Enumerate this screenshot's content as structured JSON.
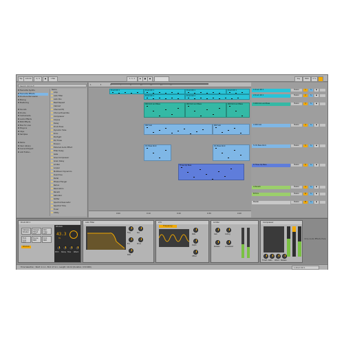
{
  "transport": {
    "tap": "Tap",
    "tempo": "120.00",
    "time_sig": "4 / 4",
    "quantize": "1 Bar",
    "position": "1. 1. 1",
    "key": "Key",
    "midi": "MIDI",
    "cpu": "5 %"
  },
  "browser": {
    "search_placeholder": "Search (Cmd+F)",
    "collections": [
      "Favourite Synths",
      "Favourite Effects",
      "Drums & Percussion",
      "Mixing",
      "Mastering"
    ],
    "categories": [
      "Sounds",
      "Drums",
      "Instruments",
      "Audio Effects",
      "MIDI Effects",
      "Max for Live",
      "Plug-ins",
      "Clips",
      "Samples"
    ],
    "places": [
      "Packs",
      "User Library",
      "Current Project",
      "Add Folder..."
    ],
    "name_header": "Name",
    "items": [
      "Amp",
      "Auto Filter",
      "Auto Pan",
      "Beat Repeat",
      "Cabinet",
      "Channel EQ",
      "Chorus-Ensemble",
      "Compressor",
      "Corpus",
      "Delay",
      "Drum Buss",
      "Dynamic Tube",
      "Echo",
      "EQ Eight",
      "EQ Three",
      "Erosion",
      "External Audio Effect",
      "Filter Delay",
      "Gate",
      "Glue Compressor",
      "Grain Delay",
      "Limiter",
      "Looper",
      "Multiband Dynamics",
      "Overdrive",
      "Pedal",
      "Phaser-Flanger",
      "Redux",
      "Resonators",
      "Reverb",
      "Saturator",
      "Shifter",
      "Spectral Resonator",
      "Spectral Time",
      "Tuner",
      "Utility"
    ]
  },
  "arrangement": {
    "ruler": [
      "1",
      "3",
      "5",
      "7",
      "9",
      "11",
      "13",
      "15",
      "17"
    ],
    "clips": [
      {
        "label": "Drum Kit 1",
        "color": "#29c4d8"
      },
      {
        "label": "Drum Kit 1",
        "color": "#29c4d8"
      },
      {
        "label": "Drum Kit 1",
        "color": "#29c4d8"
      },
      {
        "label": "Drum Kit 1",
        "color": "#29c4d8"
      },
      {
        "label": "Drum Kit 1",
        "color": "#29c4d8"
      },
      {
        "label": "Drum Kit 1",
        "color": "#29c4d8"
      },
      {
        "label": "909 Kick and Bass",
        "color": "#34b9a5"
      },
      {
        "label": "909 Kick and Bass",
        "color": "#34b9a5"
      },
      {
        "label": "909 Kick and Bass",
        "color": "#34b9a5"
      },
      {
        "label": "909 Sub",
        "color": "#7fb7e6"
      },
      {
        "label": "909 Sub",
        "color": "#7fb7e6"
      },
      {
        "label": "Chi Bass Rock",
        "color": "#7fb7e6"
      },
      {
        "label": "Chi Bass Rock",
        "color": "#7fb7e6"
      },
      {
        "label": "Three Op Bass",
        "color": "#5f7ddb"
      }
    ],
    "time_labels": [
      "0:00",
      "0:10",
      "0:20",
      "0:30",
      "0:40"
    ]
  },
  "tracks": [
    {
      "name": "1 Drum Kit 1",
      "color": "#29c4d8",
      "num": "1"
    },
    {
      "name": "2 Drum Kit 1",
      "color": "#29c4d8",
      "num": "2"
    },
    {
      "name": "3 909 Kick and Bass",
      "color": "#34b9a5",
      "num": "3"
    },
    {
      "name": "4 909 Sub",
      "color": "#7fb7e6",
      "num": "4"
    },
    {
      "name": "5 Chi Bass Rock",
      "color": "#7fb7e6",
      "num": "5"
    },
    {
      "name": "6 Three Op Bass",
      "color": "#5f7ddb",
      "num": "6"
    },
    {
      "name": "A Reverb",
      "color": "#9bcf6b",
      "num": "A"
    },
    {
      "name": "B Echo",
      "color": "#9bcf6b",
      "num": "B"
    },
    {
      "name": "Master",
      "color": "#c9c9c9",
      "num": "M"
    }
  ],
  "track_controls": {
    "master": "Master",
    "s": "S",
    "solo_color": "#6fb3e0",
    "active_color": "#f2a900"
  },
  "devices": {
    "drum_rack": {
      "title": "Drum Kit 1",
      "pads": [
        "Cabasa Shaker",
        "Closed Hihat 808",
        "Rim Clap 808",
        "Tom Low 808",
        "Snare 808",
        "Kick 808"
      ],
      "chain": "DS Kick"
    },
    "ds_kick": {
      "title": "DS Kick",
      "value": "43.3",
      "unit": "Hz",
      "labels": [
        "Pitch",
        "Decay",
        "Tone",
        "Attack"
      ]
    },
    "auto_filter": {
      "title": "Auto Filter",
      "labels": [
        "Freq",
        "Res",
        "Env",
        "Drive",
        "Rate"
      ]
    },
    "lfo": {
      "title": "LFO",
      "mode": "Frequency",
      "labels": [
        "Rate",
        "Depth",
        "Offset"
      ]
    },
    "limiter": {
      "title": "Limiter",
      "labels": [
        "Gain",
        "Ceiling",
        "Release",
        "Lookahead"
      ]
    },
    "compressor": {
      "title": "Compressor",
      "labels": [
        "Thresh",
        "Ratio",
        "Attack",
        "Release"
      ]
    },
    "drop_hint": "Drop Audio Effects Here"
  },
  "status": {
    "text": "Time Selection : Start: 1.1.1 - End: 17.1.1 - Length: 16.0.0 (Duration: 0:32:000)",
    "track_selector": "1-Drum Kit 1"
  },
  "colors": {
    "accent": "#f2a900",
    "cyan": "#29c4d8",
    "teal": "#34b9a5",
    "light_blue": "#7fb7e6",
    "blue": "#5f7ddb",
    "green": "#9bcf6b"
  }
}
